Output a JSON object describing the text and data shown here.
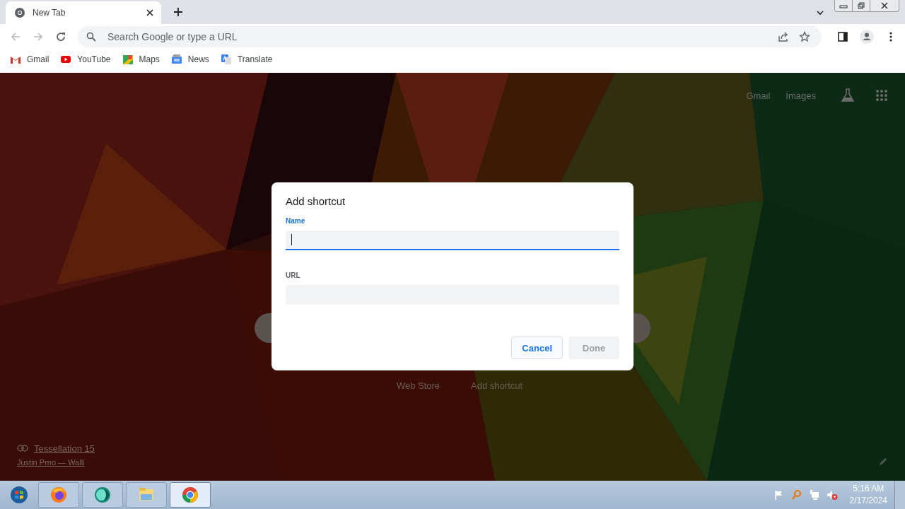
{
  "window": {
    "tab": {
      "title": "New Tab",
      "selected": true
    }
  },
  "toolbar": {
    "omnibox": {
      "placeholder": "Search Google or type a URL"
    }
  },
  "bookmarks": [
    {
      "label": "Gmail"
    },
    {
      "label": "YouTube"
    },
    {
      "label": "Maps"
    },
    {
      "label": "News"
    },
    {
      "label": "Translate"
    }
  ],
  "ntp": {
    "links": [
      "Gmail",
      "Images"
    ],
    "shortcuts": [
      "Web Store",
      "Add shortcut"
    ],
    "attribution": {
      "title": "Tessellation 15",
      "author": "Justin Prno — Walli"
    }
  },
  "dialog": {
    "title": "Add shortcut",
    "fields": [
      {
        "label": "Name",
        "focused": true
      },
      {
        "label": "URL",
        "focused": false
      }
    ],
    "buttons": [
      {
        "label": "Cancel",
        "disabled": false
      },
      {
        "label": "Done",
        "disabled": true
      }
    ]
  },
  "taskbar": {
    "apps": [
      {
        "selected": false
      },
      {
        "selected": false
      },
      {
        "selected": false
      },
      {
        "selected": true
      }
    ],
    "time": "5:16 AM",
    "date": "2/17/2024"
  }
}
